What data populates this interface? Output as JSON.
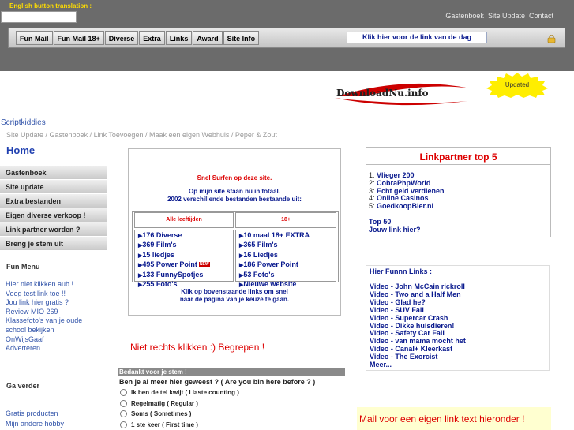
{
  "header": {
    "translation_label": "English button translation :",
    "top_links": [
      "Gastenboek",
      "Site Update",
      "Contact"
    ],
    "nav_buttons": [
      "Fun Mail",
      "Fun Mail 18+",
      "Diverse",
      "Extra",
      "Links",
      "Award",
      "Site Info"
    ],
    "day_link": "Klik hier voor de link van de dag",
    "logo_text": "DownloadNu.info",
    "updated_badge": "Updated"
  },
  "breadcrumbs": {
    "site_name": "Scriptkiddies",
    "trail": "Site Update / Gastenboek / Link Toevoegen / Maak een eigen Webhuis / Peper & Zout"
  },
  "page_title": "Home",
  "sidebar": {
    "items": [
      "Gastenboek",
      "Site update",
      "Extra bestanden",
      "Eigen diverse verkoop !",
      "Link partner worden ?",
      "Breng je stem uit"
    ],
    "fun_menu_title": "Fun Menu",
    "fun_menu_links": [
      "Hier niet klikken aub !",
      "Voeg test link toe !!",
      "Jou link hier gratis ?",
      "Review MIO 269",
      "Klassefoto's van je oude",
      "school bekijken",
      "OnWijsGaaf",
      "Adverteren"
    ],
    "ga_verder_title": "Ga verder",
    "product_links": [
      "Gratis producten",
      "Mijn andere hobby"
    ]
  },
  "center": {
    "surf_text": "Snel Surfen op deze site.",
    "info_line1": "Op mijn site staan nu in totaal.",
    "info_line2": "2002 verschillende bestanden bestaande uit:",
    "col1_header": "Alle leeftijden",
    "col2_header": "18+",
    "col1_items": [
      "176 Diverse",
      "369 Film's",
      "15 liedjes",
      "495 Power Point",
      "133 FunnySpotjes",
      "255 Foto's"
    ],
    "new_badge": "NEW",
    "col2_items": [
      "10 maal 18+ EXTRA",
      "365 Film's",
      "16 Liedjes",
      "186 Power Point",
      "53 Foto's",
      "Nieuwe website"
    ],
    "click_line1": "Klik op bovenstaande links om snel",
    "click_line2": "naar de pagina van je keuze te gaan.",
    "no_right_click": "Niet rechts klikken :) Begrepen !"
  },
  "poll": {
    "header": "Bedankt voor je stem !",
    "question": "Ben je al meer hier geweest ? ( Are you bin here before ? )",
    "options": [
      "Ik ben de tel kwijt ( I laste counting )",
      "Regelmatig ( Regular )",
      "Soms ( Sometimes )",
      "1 ste keer ( First time )"
    ]
  },
  "linkpartner": {
    "title": "Linkpartner top 5",
    "entries": [
      {
        "rank": "1:",
        "name": "Vlieger 200"
      },
      {
        "rank": "2:",
        "name": "CobraPhpWorld"
      },
      {
        "rank": "3:",
        "name": "Echt geld verdienen"
      },
      {
        "rank": "4:",
        "name": "Online Casinos"
      },
      {
        "rank": "5:",
        "name": "GoedkoopBier.nl"
      }
    ],
    "top50": "Top 50",
    "your_link": "Jouw link hier?"
  },
  "funnn": {
    "title": "Hier Funnn Links :",
    "links": [
      "Video - John McCain rickroll",
      "Video - Two and a Half Men",
      "Video - Glad he?",
      "Video - SUV Fail",
      "Video - Supercar Crash",
      "Video - Dikke huisdieren!",
      "Video - Safety Car Fail",
      "Video - van mama mocht het",
      "Video - Canal+ Kleerkast",
      "Video - The Exorcist",
      "Meer..."
    ]
  },
  "mail_text": "Mail voor een eigen link text hieronder !",
  "colors": {
    "accent_blue": "#0a1a8e",
    "link_blue": "#3355aa",
    "accent_red": "#dd0000",
    "topbar_gray": "#6b6b6b"
  }
}
